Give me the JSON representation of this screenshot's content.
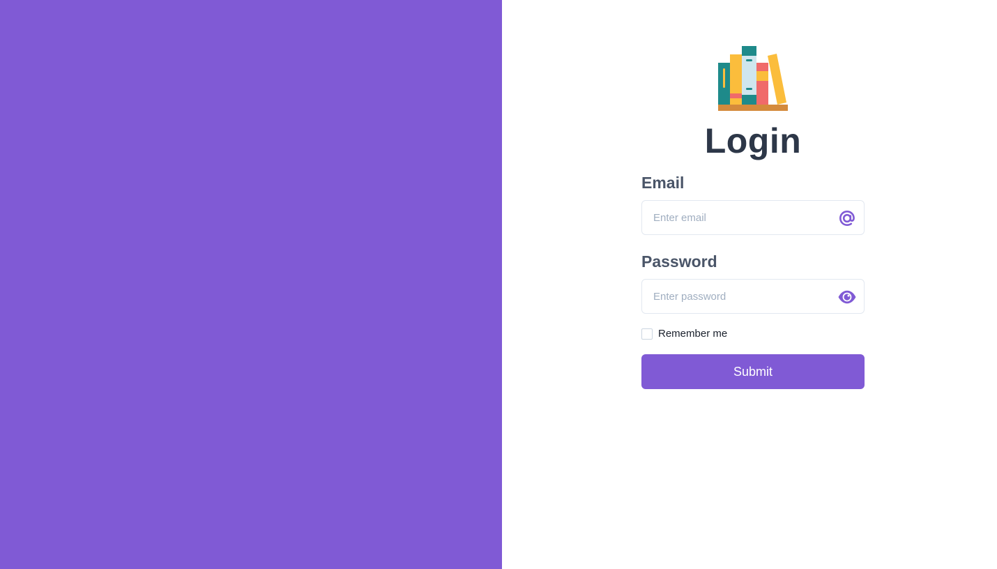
{
  "login": {
    "title": "Login",
    "email": {
      "label": "Email",
      "placeholder": "Enter email",
      "icon": "at-icon"
    },
    "password": {
      "label": "Password",
      "placeholder": "Enter password",
      "icon": "eye-icon"
    },
    "remember_label": "Remember me",
    "remember_checked": false,
    "submit_label": "Submit"
  },
  "logo": {
    "icon": "bookshelf-icon"
  },
  "colors": {
    "accent": "#805ad5",
    "title": "#2d3748",
    "label": "#4a5568",
    "input_border": "#e2e8f0",
    "placeholder": "#a0aec0"
  }
}
